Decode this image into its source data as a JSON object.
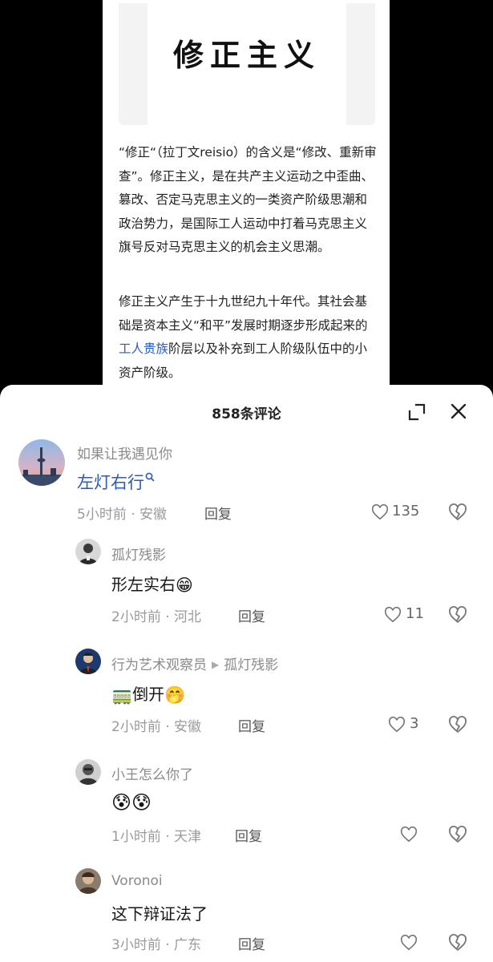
{
  "article": {
    "title": "修正主义",
    "para1": "“修正“（拉丁文reisio）的含义是“修改、重新审查”。修正主义，是在共产主义运动之中歪曲、篡改、否定马克思主义的一类资产阶级思潮和政治势力，是国际工人运动中打着马克思主义旗号反对马克思主义的机会主义思潮。",
    "para2_before": "修正主义产生于十九世纪九十年代。其社会基础是资本主义“和平”发展时期逐步形成起来的",
    "para2_link": "工人贵族",
    "para2_after": "阶层以及补充到工人阶级队伍中的小资产阶级。"
  },
  "sheet": {
    "comment_count": "858条评论"
  },
  "comments": [
    {
      "user": "如果让我遇见你",
      "text": "左灯右行",
      "time": "5小时前",
      "location": "安徽",
      "reply": "回复",
      "likes": "135"
    },
    {
      "user": "孤灯残影",
      "text": "形左实右",
      "emoji": "😁",
      "time": "2小时前",
      "location": "河北",
      "reply": "回复",
      "likes": "11"
    },
    {
      "user": "行为艺术观察员",
      "reply_to": "孤灯残影",
      "emoji_prefix": "🚃",
      "text": "倒开",
      "emoji": "🤭",
      "time": "2小时前",
      "location": "安徽",
      "reply": "回复",
      "likes": "3"
    },
    {
      "user": "小王怎么你了",
      "emoji": "😰😰",
      "time": "1小时前",
      "location": "天津",
      "reply": "回复",
      "likes": ""
    },
    {
      "user": "Voronoi",
      "text": "这下辩证法了",
      "time": "3小时前",
      "location": "广东",
      "reply": "回复",
      "likes": ""
    }
  ],
  "meta_separator": " · ",
  "icons": {
    "expand": "expand-icon",
    "close": "close-icon",
    "like": "heart-outline-icon",
    "dislike": "broken-heart-icon",
    "search": "search-icon"
  },
  "colors": {
    "link": "#2a5bb8",
    "muted": "#8a8a8a"
  }
}
